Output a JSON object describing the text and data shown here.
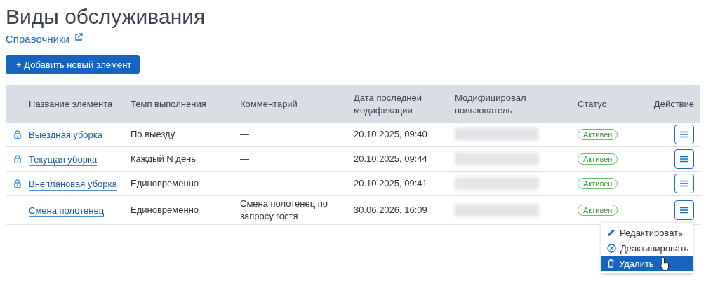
{
  "page": {
    "title": "Виды обслуживания",
    "link": "Справочники"
  },
  "add_button": "+ Добавить новый элемент",
  "table": {
    "columns": [
      "Название элемента",
      "Темп выполнения",
      "Комментарий",
      "Дата последней модификации",
      "Модифицировал пользователь",
      "Статус",
      "Действие"
    ],
    "rows": [
      {
        "locked": true,
        "name": "Выездная уборка",
        "tempo": "По выезду",
        "comment": "—",
        "date": "20.10.2025, 09:40",
        "status": "Активен"
      },
      {
        "locked": true,
        "name": "Текущая уборка",
        "tempo": "Каждый N день",
        "comment": "—",
        "date": "20.10.2025, 09:44",
        "status": "Активен"
      },
      {
        "locked": true,
        "name": "Внеплановая уборка",
        "tempo": "Единовременно",
        "comment": "—",
        "date": "20.10.2025, 09:41",
        "status": "Активен"
      },
      {
        "locked": false,
        "name": "Смена полотенец",
        "tempo": "Единовременно",
        "comment": "Смена полотенец по запросу гостя",
        "date": "30.06.2026, 16:09",
        "status": "Активен"
      }
    ]
  },
  "action_menu": {
    "items": [
      {
        "kind": "edit",
        "label": "Редактировать",
        "selected": false
      },
      {
        "kind": "deactivate",
        "label": "Деактивировать",
        "selected": false
      },
      {
        "kind": "delete",
        "label": "Удалить",
        "selected": true
      }
    ]
  }
}
